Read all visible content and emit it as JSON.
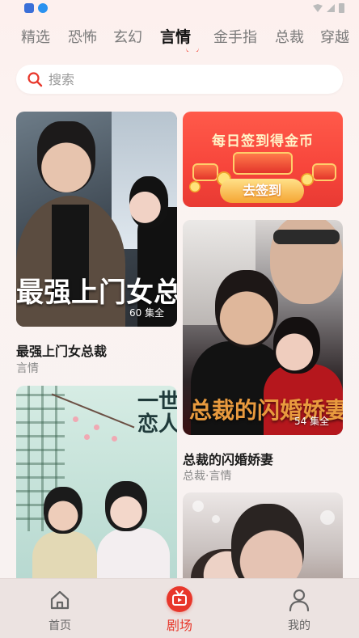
{
  "colors": {
    "accent": "#e8372b",
    "tab_active": "#111111",
    "tab_inactive": "#7b7b7b",
    "background": "#fbf3f1"
  },
  "tabs": [
    {
      "label": "精选"
    },
    {
      "label": "恐怖"
    },
    {
      "label": "玄幻"
    },
    {
      "label": "言情",
      "active": true
    },
    {
      "label": "金手指"
    },
    {
      "label": "总裁"
    },
    {
      "label": "穿越"
    }
  ],
  "search": {
    "placeholder": "搜索",
    "icon": "search-icon"
  },
  "banner": {
    "title": "每日签到得金币",
    "button_label": "去签到"
  },
  "dramas": [
    {
      "poster_text": "最强上门女总裁",
      "episodes": "60 集全",
      "title": "最强上门女总裁",
      "tags": "言情"
    },
    {
      "poster_text": "总裁的闪婚娇妻",
      "episodes": "54 集全",
      "title": "总裁的闪婚娇妻",
      "tags": "总裁·言情"
    },
    {
      "poster_text": "一世恋人"
    },
    {
      "poster_text": ""
    }
  ],
  "bottom_nav": [
    {
      "label": "首页",
      "icon": "home-icon"
    },
    {
      "label": "剧场",
      "icon": "tv-icon",
      "active": true
    },
    {
      "label": "我的",
      "icon": "profile-icon"
    }
  ]
}
